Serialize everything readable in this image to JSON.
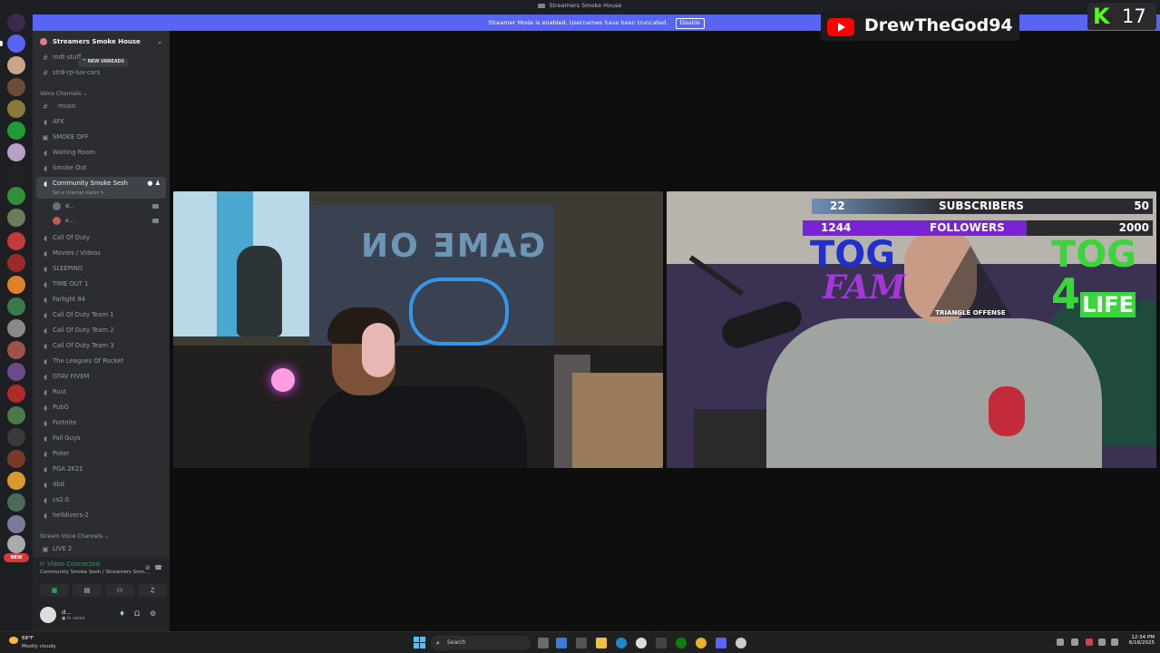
{
  "window": {
    "title": "Streamers Smoke House"
  },
  "banner": {
    "text": "Streamer Mode is enabled. Usernames have been truncated.",
    "disable_label": "Disable"
  },
  "server": {
    "name": "Streamers Smoke House"
  },
  "new_unreads": "NEW UNREADS",
  "new_badge": "NEW",
  "text_channels": [
    "mdt-stuff",
    "str8-rp-lux-cars"
  ],
  "voice_category": "Voice Channels",
  "voice_channels_top": [
    "music",
    "AFK",
    "SMOKE OFF",
    "Waiting Room",
    "Smoke Out"
  ],
  "active_channel": {
    "name": "Community Smoke Sesh",
    "status": "Set a channel status"
  },
  "voice_users": [
    "d...",
    "x..."
  ],
  "voice_channels_bottom": [
    "Call Of Duty",
    "Movies / Videos",
    "SLEEPING",
    "TIME OUT 1",
    "Farlight 84",
    "Call Of Duty Team 1",
    "Call Of Duty Team 2",
    "Call Of Duty Team 3",
    "The Leagues Of Rocket",
    "GTAV FIVEM",
    "Rust",
    "PubG",
    "Fortnite",
    "Fall Guys",
    "Poker",
    "PGA 2K21",
    "dbd",
    "cs2.0",
    "helldivers-2"
  ],
  "stream_category": "Stream Voice Channels",
  "stream_channels": [
    "LIVE 2"
  ],
  "voice_panel": {
    "status": "Video Connected",
    "location": "Community Smoke Sesh / Streamers Smo..."
  },
  "user_panel": {
    "name": "d...",
    "status": "In voice"
  },
  "overlay": {
    "subscribers": {
      "current": "22",
      "label": "SUBSCRIBERS",
      "goal": "50"
    },
    "followers": {
      "current": "1244",
      "label": "FOLLOWERS",
      "goal": "2000"
    },
    "tog_left": "TOG",
    "fam": "FAM",
    "tog_right": "TOG",
    "four": "4",
    "life": "LIFE",
    "logo_text": "TRIANGLE OFFENSE",
    "wall_sign": "GAME ON",
    "youtube_name": "DrewTheGod94",
    "kick_count": "17",
    "kick_letter": "K"
  },
  "taskbar": {
    "temperature": "68°F",
    "weather": "Mostly cloudy",
    "search_placeholder": "Search",
    "time": "12:34 PM",
    "date": "6/18/2025"
  },
  "colors": {
    "accent": "#5865f2",
    "connected": "#23a559",
    "kick": "#53fc18",
    "youtube": "#ff0000"
  }
}
